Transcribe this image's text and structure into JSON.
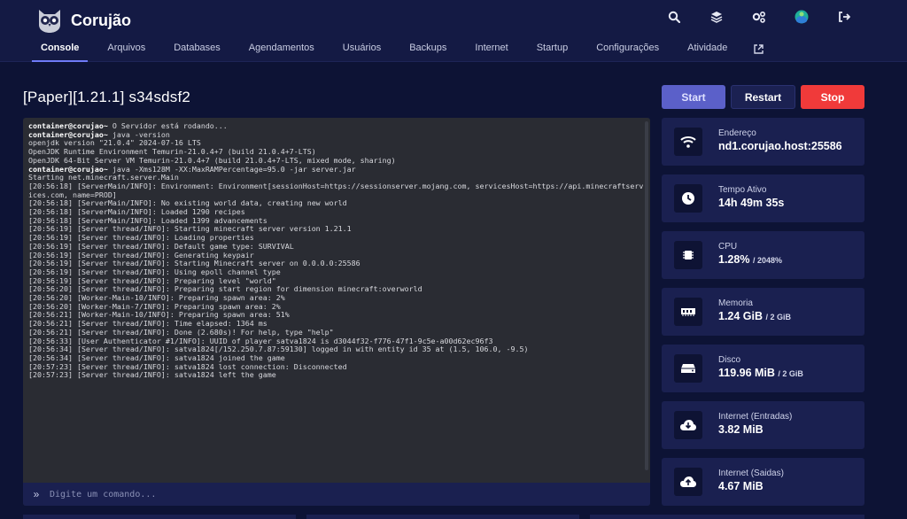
{
  "app": {
    "name": "Corujão"
  },
  "nav": {
    "items": [
      "Console",
      "Arquivos",
      "Databases",
      "Agendamentos",
      "Usuários",
      "Backups",
      "Internet",
      "Startup",
      "Configurações",
      "Atividade"
    ],
    "active": "Console"
  },
  "server": {
    "title": "[Paper][1.21.1] s34sdsf2"
  },
  "controls": {
    "start": "Start",
    "restart": "Restart",
    "stop": "Stop"
  },
  "console": {
    "lines": [
      {
        "prompt": "container@corujao~",
        "text": " O Servidor está rodando..."
      },
      {
        "prompt": "container@corujao~",
        "text": " java -version"
      },
      {
        "prompt": "",
        "text": "openjdk version \"21.0.4\" 2024-07-16 LTS"
      },
      {
        "prompt": "",
        "text": "OpenJDK Runtime Environment Temurin-21.0.4+7 (build 21.0.4+7-LTS)"
      },
      {
        "prompt": "",
        "text": "OpenJDK 64-Bit Server VM Temurin-21.0.4+7 (build 21.0.4+7-LTS, mixed mode, sharing)"
      },
      {
        "prompt": "container@corujao~",
        "text": " java -Xms128M -XX:MaxRAMPercentage=95.0 -jar server.jar"
      },
      {
        "prompt": "",
        "text": "Starting net.minecraft.server.Main"
      },
      {
        "prompt": "",
        "text": "[20:56:18] [ServerMain/INFO]: Environment: Environment[sessionHost=https://sessionserver.mojang.com, servicesHost=https://api.minecraftservices.com, name=PROD]"
      },
      {
        "prompt": "",
        "text": "[20:56:18] [ServerMain/INFO]: No existing world data, creating new world"
      },
      {
        "prompt": "",
        "text": "[20:56:18] [ServerMain/INFO]: Loaded 1290 recipes"
      },
      {
        "prompt": "",
        "text": "[20:56:18] [ServerMain/INFO]: Loaded 1399 advancements"
      },
      {
        "prompt": "",
        "text": "[20:56:19] [Server thread/INFO]: Starting minecraft server version 1.21.1"
      },
      {
        "prompt": "",
        "text": "[20:56:19] [Server thread/INFO]: Loading properties"
      },
      {
        "prompt": "",
        "text": "[20:56:19] [Server thread/INFO]: Default game type: SURVIVAL"
      },
      {
        "prompt": "",
        "text": "[20:56:19] [Server thread/INFO]: Generating keypair"
      },
      {
        "prompt": "",
        "text": "[20:56:19] [Server thread/INFO]: Starting Minecraft server on 0.0.0.0:25586"
      },
      {
        "prompt": "",
        "text": "[20:56:19] [Server thread/INFO]: Using epoll channel type"
      },
      {
        "prompt": "",
        "text": "[20:56:19] [Server thread/INFO]: Preparing level \"world\""
      },
      {
        "prompt": "",
        "text": "[20:56:20] [Server thread/INFO]: Preparing start region for dimension minecraft:overworld"
      },
      {
        "prompt": "",
        "text": "[20:56:20] [Worker-Main-10/INFO]: Preparing spawn area: 2%"
      },
      {
        "prompt": "",
        "text": "[20:56:20] [Worker-Main-7/INFO]: Preparing spawn area: 2%"
      },
      {
        "prompt": "",
        "text": "[20:56:21] [Worker-Main-10/INFO]: Preparing spawn area: 51%"
      },
      {
        "prompt": "",
        "text": "[20:56:21] [Server thread/INFO]: Time elapsed: 1364 ms"
      },
      {
        "prompt": "",
        "text": "[20:56:21] [Server thread/INFO]: Done (2.680s)! For help, type \"help\""
      },
      {
        "prompt": "",
        "text": "[20:56:33] [User Authenticator #1/INFO]: UUID of player satva1824 is d3044f32-f776-47f1-9c5e-a00d62ec96f3"
      },
      {
        "prompt": "",
        "text": "[20:56:34] [Server thread/INFO]: satva1824[/152.250.7.87:59130] logged in with entity id 35 at (1.5, 106.0, -9.5)"
      },
      {
        "prompt": "",
        "text": "[20:56:34] [Server thread/INFO]: satva1824 joined the game"
      },
      {
        "prompt": "",
        "text": "[20:57:23] [Server thread/INFO]: satva1824 lost connection: Disconnected"
      },
      {
        "prompt": "",
        "text": "[20:57:23] [Server thread/INFO]: satva1824 left the game"
      }
    ],
    "input_placeholder": "Digite um comando..."
  },
  "stats": [
    {
      "icon": "wifi-icon",
      "label": "Endereço",
      "value": "nd1.corujao.host:25586",
      "sub": ""
    },
    {
      "icon": "clock-icon",
      "label": "Tempo Ativo",
      "value": "14h 49m 35s",
      "sub": ""
    },
    {
      "icon": "cpu-icon",
      "label": "CPU",
      "value": "1.28%",
      "sub": "/ 2048%"
    },
    {
      "icon": "memory-icon",
      "label": "Memoria",
      "value": "1.24 GiB",
      "sub": "/ 2 GiB"
    },
    {
      "icon": "disk-icon",
      "label": "Disco",
      "value": "119.96 MiB",
      "sub": "/ 2 GiB"
    },
    {
      "icon": "cloud-download-icon",
      "label": "Internet (Entradas)",
      "value": "3.82 MiB",
      "sub": ""
    },
    {
      "icon": "cloud-upload-icon",
      "label": "Internet (Saidas)",
      "value": "4.67 MiB",
      "sub": ""
    }
  ]
}
